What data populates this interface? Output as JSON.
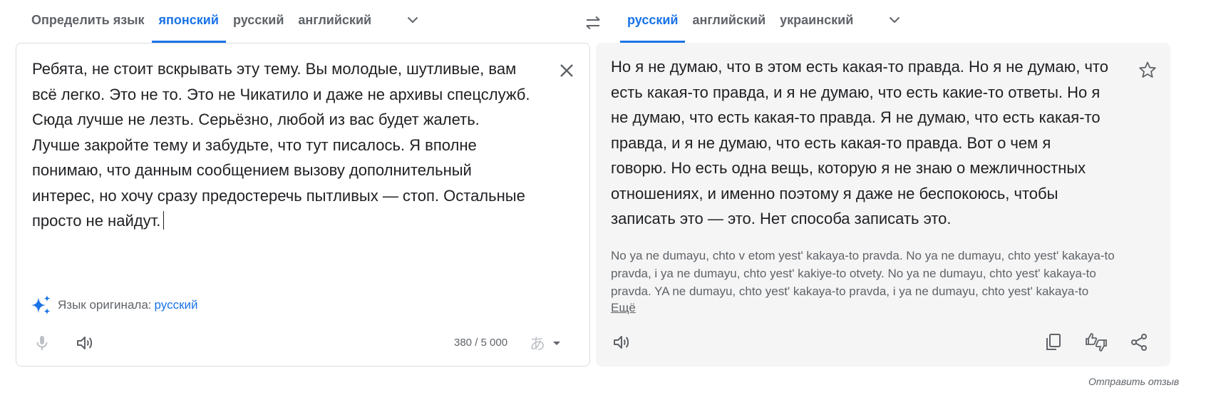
{
  "source_langs": {
    "tabs": [
      {
        "label": "Определить язык",
        "active": false
      },
      {
        "label": "японский",
        "active": true
      },
      {
        "label": "русский",
        "active": false
      },
      {
        "label": "английский",
        "active": false
      }
    ],
    "more_icon": "chevron-down-icon"
  },
  "swap_icon": "swap-arrows-icon",
  "target_langs": {
    "tabs": [
      {
        "label": "русский",
        "active": true
      },
      {
        "label": "английский",
        "active": false
      },
      {
        "label": "украинский",
        "active": false
      }
    ],
    "more_icon": "chevron-down-icon"
  },
  "source": {
    "text": "Ребята, не стоит вскрывать эту тему. Вы молодые, шутливые, вам всё легко. Это не то. Это не Чикатило и даже не архивы спецслужб. Сюда лучше не лезть. Серьёзно, любой из вас будет жалеть. Лучше закройте тему и забудьте, что тут писалось. Я вполне понимаю, что данным сообщением вызову дополнительный интерес, но хочу сразу предостеречь пытливых — стоп. Остальные просто не найдут.",
    "detected_label": "Язык оригинала:",
    "detected_lang": "русский",
    "char_count": "380 / 5 000",
    "ime_glyph": "あ"
  },
  "target": {
    "text": "Но я не думаю, что в этом есть какая-то правда. Но я не думаю, что есть какая-то правда, и я не думаю, что есть какие-то ответы. Но я не думаю, что есть какая-то правда. Я не думаю, что есть какая-то правда, и я не думаю, что есть какая-то правда. Вот о чем я говорю. Но есть одна вещь, которую я не знаю о межличностных отношениях, и именно поэтому я даже не беспокоюсь, чтобы записать это — это. Нет способа записать это.",
    "transliteration": "No ya ne dumayu, chto v etom yest' kakaya-to pravda. No ya ne dumayu, chto yest' kakaya-to pravda, i ya ne dumayu, chto yest' kakiye-to otvety. No ya ne dumayu, chto yest' kakaya-to pravda. YA ne dumayu, chto yest' kakaya-to pravda, i ya ne dumayu, chto yest' kakaya-to",
    "more_label": "Ещё"
  },
  "feedback_label": "Отправить отзыв",
  "colors": {
    "accent": "#1a73e8",
    "text": "#202124",
    "secondary": "#5f6368",
    "target_bg": "#f5f5f5",
    "border": "#dadce0"
  }
}
